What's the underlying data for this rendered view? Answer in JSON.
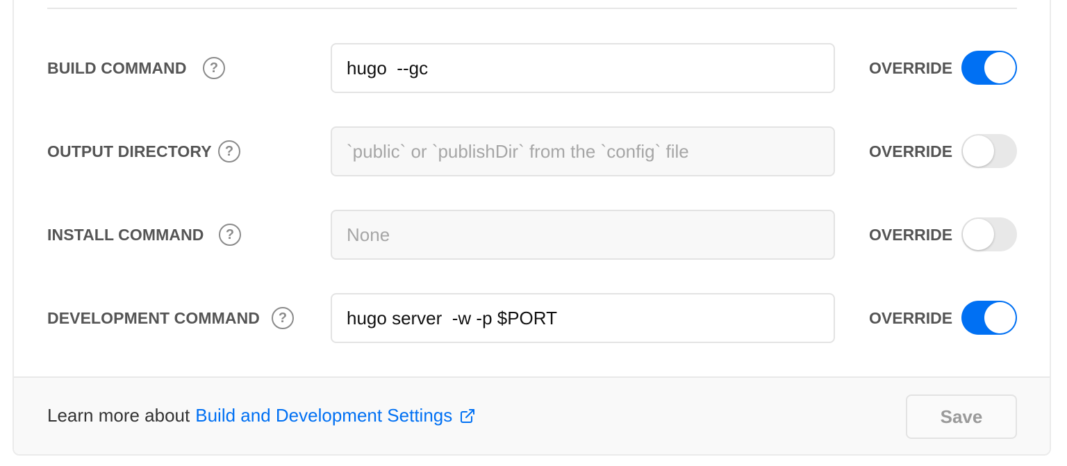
{
  "rows": [
    {
      "label": "BUILD COMMAND",
      "value": "hugo  --gc",
      "placeholder": "",
      "override_label": "OVERRIDE",
      "override_on": true
    },
    {
      "label": "OUTPUT DIRECTORY",
      "value": "",
      "placeholder": "`public` or `publishDir` from the `config` file",
      "override_label": "OVERRIDE",
      "override_on": false
    },
    {
      "label": "INSTALL COMMAND",
      "value": "",
      "placeholder": "None",
      "override_label": "OVERRIDE",
      "override_on": false
    },
    {
      "label": "DEVELOPMENT COMMAND",
      "value": "hugo server  -w -p $PORT",
      "placeholder": "",
      "override_label": "OVERRIDE",
      "override_on": true
    }
  ],
  "help_glyph": "?",
  "footer": {
    "prefix": "Learn more about",
    "link_text": "Build and Development Settings",
    "save_label": "Save"
  },
  "colors": {
    "accent": "#0070f3",
    "toggle_off": "#e8e8e8",
    "label": "#555555"
  },
  "icons": {
    "help": "question-circle-icon",
    "external": "external-link-icon"
  }
}
